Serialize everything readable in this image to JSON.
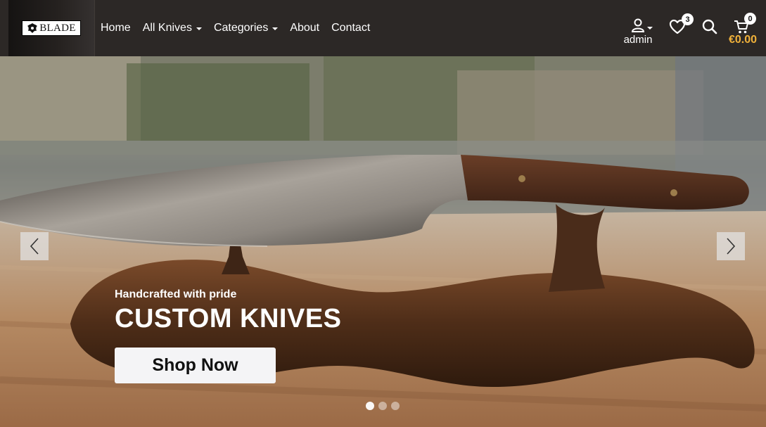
{
  "header": {
    "logo_text": "BLADE",
    "nav": [
      {
        "label": "Home",
        "has_dropdown": false
      },
      {
        "label": "All Knives",
        "has_dropdown": true
      },
      {
        "label": "Categories",
        "has_dropdown": true
      },
      {
        "label": "About",
        "has_dropdown": false
      },
      {
        "label": "Contact",
        "has_dropdown": false
      }
    ],
    "user": {
      "name": "admin",
      "icon": "user-icon"
    },
    "wishlist": {
      "icon": "heart-icon",
      "count": "3"
    },
    "search": {
      "icon": "search-icon"
    },
    "cart": {
      "icon": "cart-icon",
      "count": "0",
      "total": "€0.00"
    }
  },
  "hero": {
    "subtitle": "Handcrafted with pride",
    "title": "CUSTOM KNIVES",
    "cta_label": "Shop Now",
    "prev_icon": "chevron-left-icon",
    "next_icon": "chevron-right-icon",
    "slides_count": 3,
    "active_slide": 1
  },
  "colors": {
    "header_bg": "#2c2826",
    "accent_price": "#f0b13a",
    "cta_bg": "#f4f4f6"
  }
}
